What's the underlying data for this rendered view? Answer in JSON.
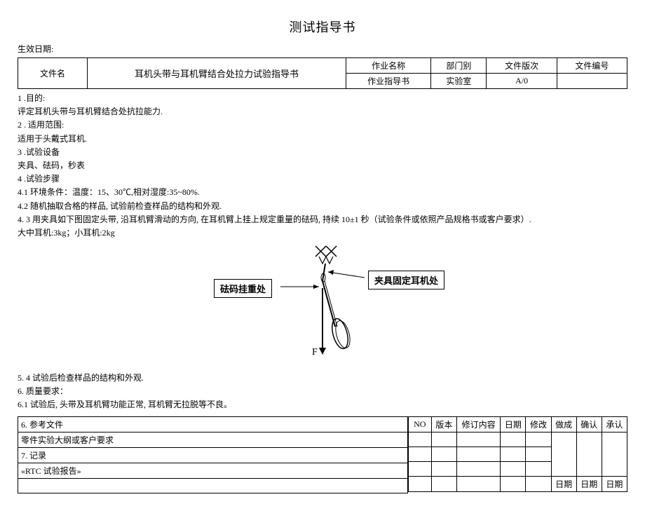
{
  "title": "测试指导书",
  "effective_date_label": "生效日期:",
  "header": {
    "file_name_label": "文件名",
    "file_name_value": "耳机头带与耳机臂结合处拉力试验指导书",
    "job_name_label": "作业名称",
    "dept_label": "部门别",
    "file_ver_label": "文件版次",
    "file_no_label": "文件编号",
    "job_name_value": "作业指导书",
    "dept_value": "实验室",
    "file_ver_value": "A/0",
    "file_no_value": ""
  },
  "sections": {
    "s1_h": "1  .目的:",
    "s1_b": "评定耳机头带与耳机臂结合处抗拉能力.",
    "s2_h": "2  . 适用范围:",
    "s2_b": "适用于头戴式耳机.",
    "s3_h": "3  .试验设备",
    "s3_b": "夹具、砝码，秒表",
    "s4_h": "4  .试验步骤",
    "s4_1": "4.1 环境条件：温度：15、30℃,相对湿度:35~80%.",
    "s4_2": "4.2 随机抽取合格的样品, 试验前检查样品的结构和外观.",
    "s4_3": "4.  3 用夹具如下图固定头带, 沿耳机臂滑动的方向, 在耳机臂上挂上规定重量的砝码, 持续 10±1 秒（试验条件或依照产品规格书或客户要求）.",
    "s4_3b": "大中耳机:3kg；小耳机:2kg",
    "s5": "5.   4 试验后检查样品的结构和外观.",
    "s6": "6.   质量要求：",
    "s6_1": "6.1    试验后, 头带及耳机臂功能正常, 耳机臂无拉脱等不良。"
  },
  "diagram": {
    "left_label": "砝码挂重处",
    "right_label": "夹具固定耳机处",
    "force_label": "F"
  },
  "footer_left": {
    "r1": "6. 参考文件",
    "r2": "零件实验大纲或客户要求",
    "r3": "7. 记录",
    "r4": "«RTC 试验报告»"
  },
  "footer_right": {
    "no": "NO",
    "ver": "版本",
    "rev_content": "修订内容",
    "date": "日期",
    "modify": "修改",
    "make": "做成",
    "confirm": "确认",
    "approve": "承认"
  }
}
